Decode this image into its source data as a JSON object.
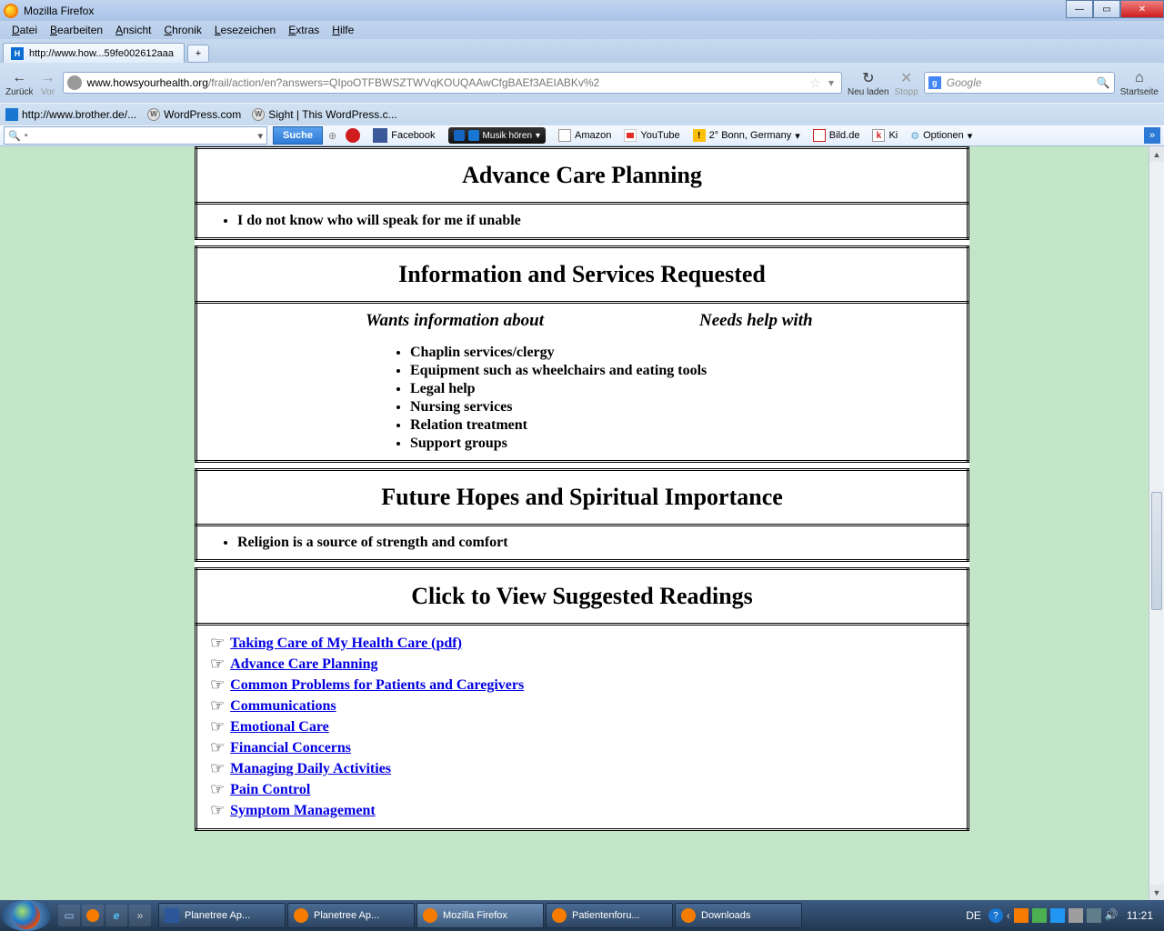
{
  "window": {
    "title": "Mozilla Firefox"
  },
  "menu": {
    "items": [
      "Datei",
      "Bearbeiten",
      "Ansicht",
      "Chronik",
      "Lesezeichen",
      "Extras",
      "Hilfe"
    ]
  },
  "tabs": {
    "active": "http://www.how...59fe002612aaa"
  },
  "nav": {
    "back": "Zurück",
    "forward": "Vor",
    "reload": "Neu laden",
    "stop": "Stopp",
    "home": "Startseite",
    "url_host": "www.howsyourhealth.org",
    "url_path": "/frail/action/en?answers=QIpoOTFBWSZTWVqKOUQAAwCfgBAEf3AEIABKv%2",
    "search_placeholder": "Google"
  },
  "bookmarks": {
    "items": [
      "http://www.brother.de/...",
      "WordPress.com",
      "Sight | This WordPress.c..."
    ]
  },
  "toolbar": {
    "search_btn": "Suche",
    "facebook": "Facebook",
    "media": "Musik hören",
    "amazon": "Amazon",
    "youtube": "YouTube",
    "weather": "2° Bonn, Germany",
    "bild": "Bild.de",
    "ki": "Ki",
    "optionen": "Optionen"
  },
  "content": {
    "section1": {
      "heading": "Advance Care Planning",
      "items": [
        "I do not know who will speak for me if unable"
      ]
    },
    "section2": {
      "heading": "Information and Services Requested",
      "sub1": "Wants information about",
      "sub2": "Needs help with",
      "items": [
        "Chaplin services/clergy",
        "Equipment such as wheelchairs and eating tools",
        "Legal help",
        "Nursing services",
        "Relation treatment",
        "Support groups"
      ]
    },
    "section3": {
      "heading": "Future Hopes and Spiritual Importance",
      "items": [
        "Religion is a source of strength and comfort"
      ]
    },
    "section4": {
      "heading": "Click to View Suggested Readings",
      "links": [
        "Taking Care of My Health Care (pdf)",
        "Advance Care Planning",
        "Common Problems for Patients and Caregivers",
        "Communications",
        "Emotional Care",
        "Financial Concerns",
        "Managing Daily Activities",
        "Pain Control",
        "Symptom Management"
      ]
    }
  },
  "taskbar": {
    "buttons": [
      "Planetree Ap...",
      "Planetree Ap...",
      "Mozilla Firefox",
      "Patientenforu...",
      "Downloads"
    ],
    "lang": "DE",
    "clock": "11:21"
  }
}
